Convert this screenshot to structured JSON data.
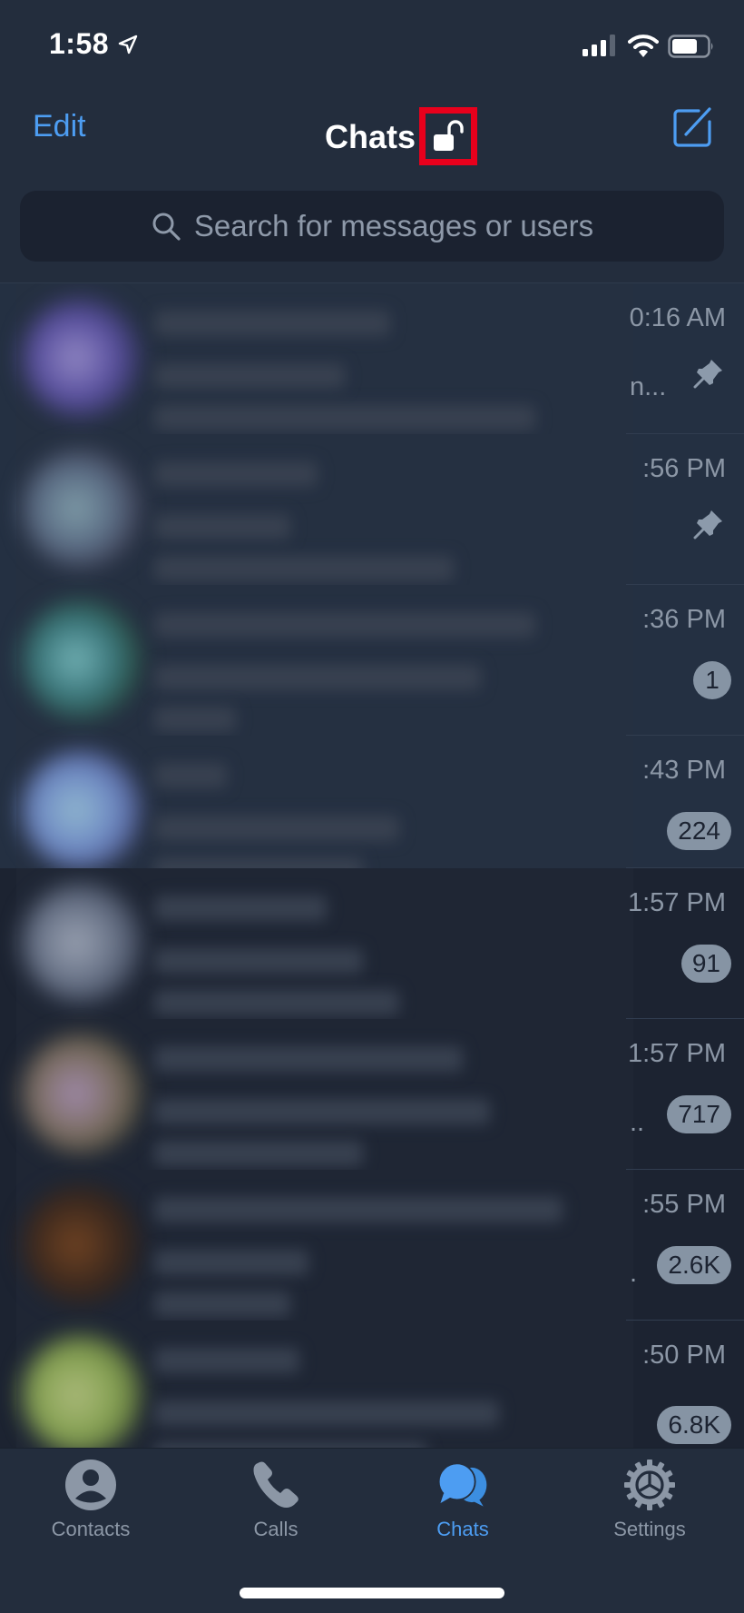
{
  "status_bar": {
    "time": "1:58",
    "icons": [
      "location-arrow-icon",
      "cellular-signal-icon",
      "wifi-icon",
      "battery-icon"
    ]
  },
  "nav": {
    "edit_label": "Edit",
    "title": "Chats",
    "lock_icon": "unlocked-padlock-icon",
    "compose_icon": "compose-icon",
    "annotation_color": "#e8001c"
  },
  "search": {
    "placeholder": "Search for messages or users",
    "value": ""
  },
  "chats": [
    {
      "time": "0:16 AM",
      "pinned": true,
      "badge": null,
      "preview_tail": "n...",
      "avatar_colors": [
        "#b7a8f0",
        "#6b5cc0",
        "#2a2f55"
      ]
    },
    {
      "time": ":56 PM",
      "pinned": true,
      "badge": null,
      "preview_tail": "",
      "avatar_colors": [
        "#9ec2cc",
        "#6a7f9a",
        "#3a3448"
      ]
    },
    {
      "time": ":36 PM",
      "pinned": false,
      "badge": "1",
      "preview_tail": "",
      "avatar_colors": [
        "#8fe0df",
        "#3f8b8c",
        "#24462a"
      ]
    },
    {
      "time": ":43 PM",
      "pinned": false,
      "badge": "224",
      "preview_tail": "",
      "avatar_colors": [
        "#b5e6ff",
        "#86a8f0",
        "#4b4f8a"
      ]
    },
    {
      "time": "1:57 PM",
      "pinned": false,
      "badge": "91",
      "preview_tail": "",
      "avatar_colors": [
        "#c0c8d8",
        "#7f8aa0",
        "#3c4458"
      ]
    },
    {
      "time": "1:57 PM",
      "pinned": false,
      "badge": "717",
      "preview_tail": "..",
      "avatar_colors": [
        "#c8a8d0",
        "#9a8472",
        "#4a4a2a"
      ]
    },
    {
      "time": ":55 PM",
      "pinned": false,
      "badge": "2.6K",
      "preview_tail": ".",
      "avatar_colors": [
        "#8a4a18",
        "#4a2a14",
        "#1e1a18"
      ]
    },
    {
      "time": ":50 PM",
      "pinned": false,
      "badge": "6.8K",
      "preview_tail": "",
      "avatar_colors": [
        "#d8e890",
        "#a6c85a",
        "#5a7030"
      ]
    }
  ],
  "tabs": [
    {
      "label": "Contacts",
      "icon": "person-circle-icon",
      "active": false
    },
    {
      "label": "Calls",
      "icon": "phone-icon",
      "active": false
    },
    {
      "label": "Chats",
      "icon": "chat-bubbles-icon",
      "active": true
    },
    {
      "label": "Settings",
      "icon": "gear-icon",
      "active": false
    }
  ],
  "colors": {
    "accent": "#4d9df2",
    "background": "#1b2230",
    "bar_background": "#232d3d",
    "muted_text": "#8c97a6",
    "badge_background": "#8694a4"
  }
}
